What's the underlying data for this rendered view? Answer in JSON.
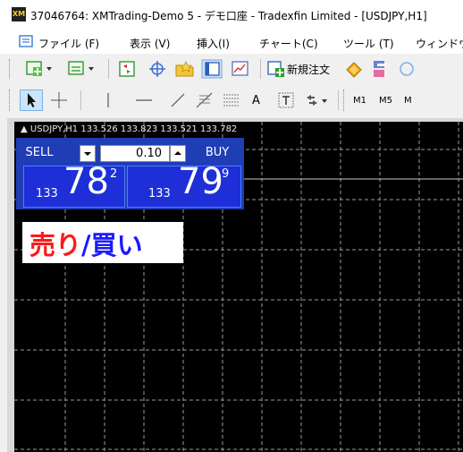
{
  "window": {
    "title": "37046764: XMTrading-Demo 5 - デモ口座 - Tradexfin Limited - [USDJPY,H1]"
  },
  "menu": {
    "items": [
      "ファイル (F)",
      "表示 (V)",
      "挿入(I)",
      "チャート(C)",
      "ツール (T)",
      "ウィンドウ"
    ]
  },
  "toolbar": {
    "new_order_label": "新規注文"
  },
  "drawing_toolbar": {
    "text_tool_label": "A",
    "timeframes": [
      "M1",
      "M5",
      "M"
    ]
  },
  "chart": {
    "header": "USDJPY,H1  133.526 133.823 133.521 133.782",
    "background": "#000000",
    "grid_color": "#9a9a9a"
  },
  "one_click": {
    "sell_label": "SELL",
    "buy_label": "BUY",
    "lot": "0.10",
    "bid": {
      "prefix": "133",
      "big": "78",
      "sup": "2"
    },
    "ask": {
      "prefix": "133",
      "big": "79",
      "sup": "9"
    },
    "panel_color": "#1f3db5"
  },
  "annotation": {
    "sell_text": "売り",
    "slash": "/",
    "buy_text": "買い",
    "sell_color": "#ff1a1a",
    "slash_color": "#1a1aff",
    "buy_color": "#1a1aff"
  }
}
